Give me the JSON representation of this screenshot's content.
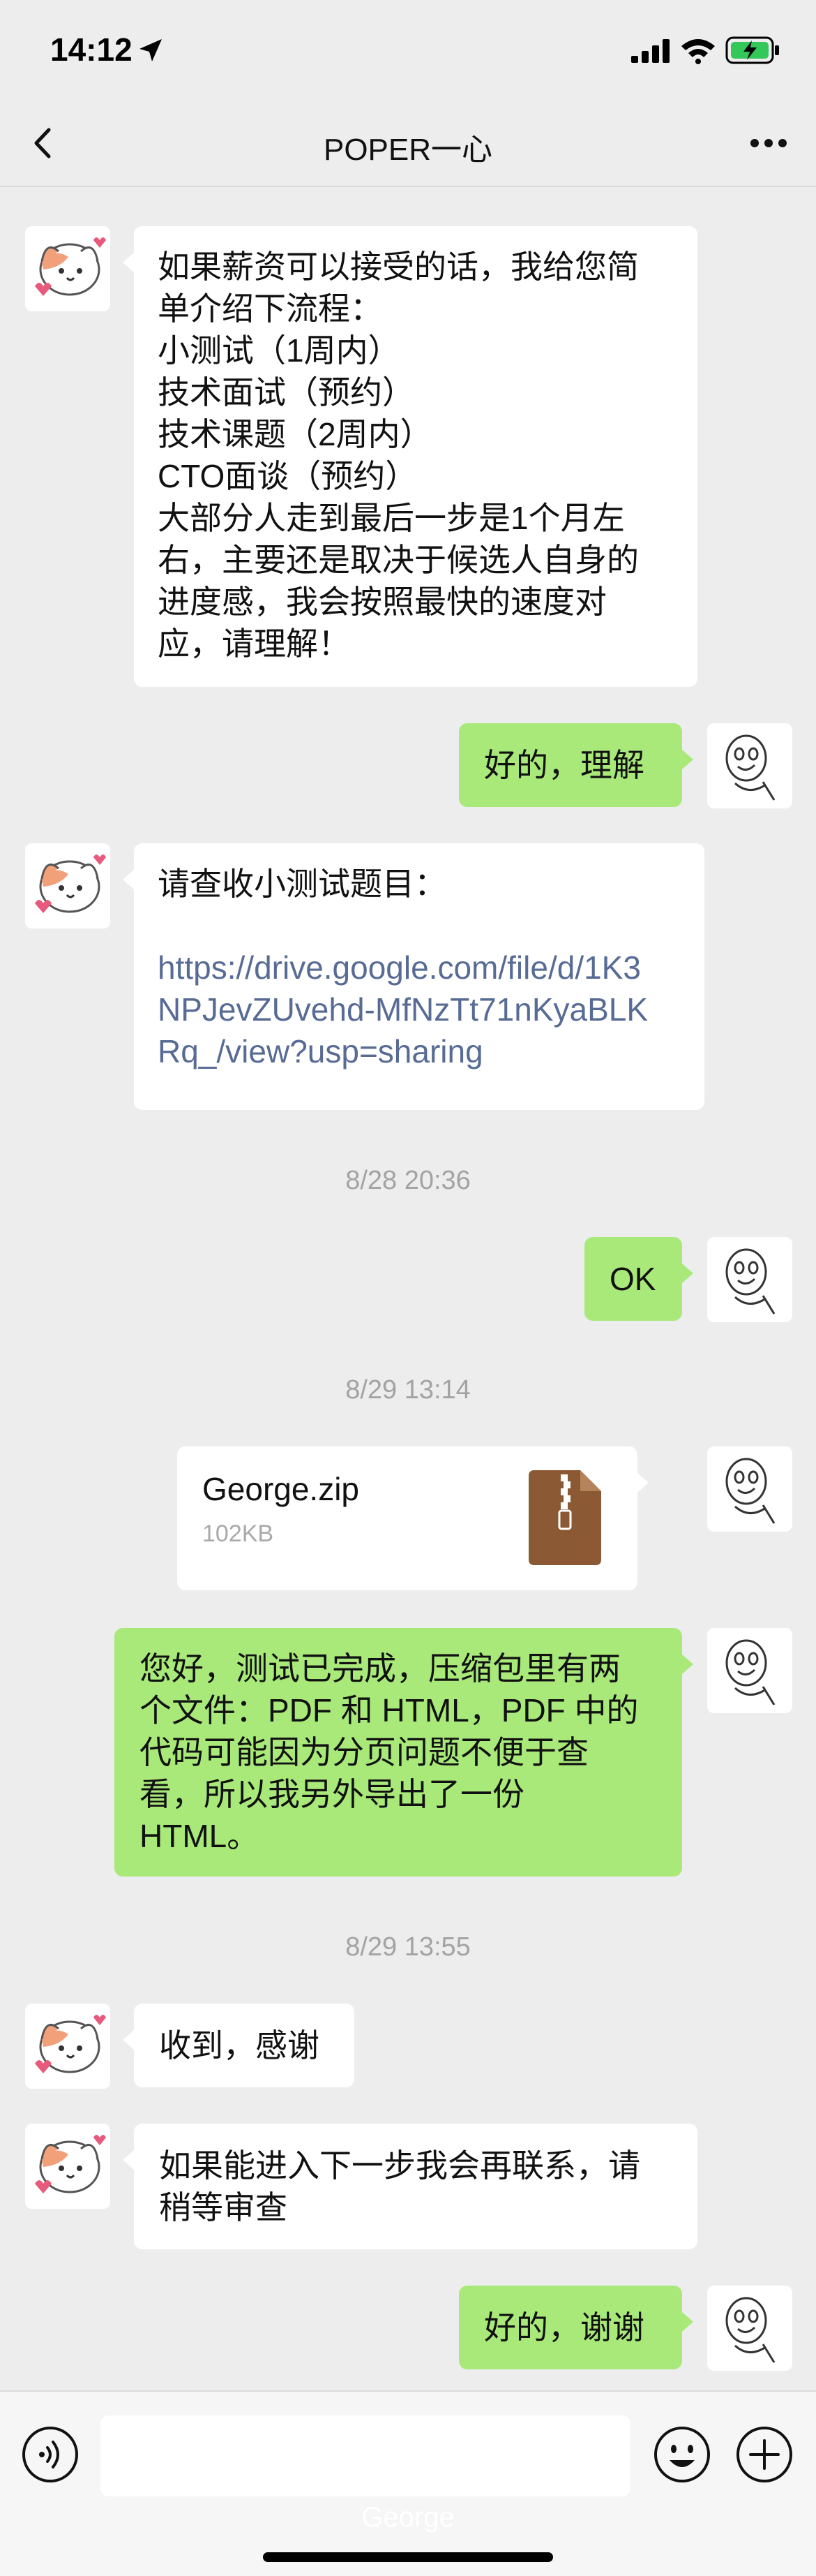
{
  "status_bar": {
    "time": "14:12"
  },
  "header": {
    "title": "POPER一心"
  },
  "messages": [
    {
      "side": "in",
      "text": "如果薪资可以接受的话，我给您简\n单介绍下流程：\n小测试（1周内）\n技术面试（预约）\n技术课题（2周内）\nCTO面谈（预约）\n大部分人走到最后一步是1个月左\n右，主要还是取决于候选人自身的\n进度感，我会按照最快的速度对\n应，请理解！"
    },
    {
      "side": "out",
      "text": "好的，理解"
    },
    {
      "side": "in",
      "text": "请查收小测试题目：",
      "link": "https://drive.google.com/file/d/1K3\nNPJevZUvehd-MfNzTt71nKyaBLK\nRq_/view?usp=sharing"
    },
    {
      "side": "out",
      "text": "OK"
    },
    {
      "side": "out",
      "type": "file",
      "file_name": "George.zip",
      "file_size": "102KB"
    },
    {
      "side": "out",
      "text": "您好，测试已完成，压缩包里有两\n个文件：PDF 和 HTML，PDF 中的\n代码可能因为分页问题不便于查\n看，所以我另外导出了一份\nHTML。"
    },
    {
      "side": "in",
      "text": "收到，感谢"
    },
    {
      "side": "in",
      "text": "如果能进入下一步我会再联系，请\n稍等审查"
    },
    {
      "side": "out",
      "text": "好的，谢谢"
    }
  ],
  "timestamps": [
    "8/28 20:36",
    "8/29 13:14",
    "8/29 13:55"
  ],
  "input": {
    "ghost_text": "George"
  },
  "colors": {
    "background": "#ededed",
    "outgoing_bubble": "#a9e97a",
    "incoming_bubble": "#ffffff",
    "link": "#576b95",
    "timestamp": "#a3a3a3"
  },
  "icons": [
    "location-arrow-icon",
    "cellular-signal-icon",
    "wifi-icon",
    "battery-charging-icon",
    "back-chevron-icon",
    "more-dots-icon",
    "cat-avatar-icon",
    "sketch-face-avatar-icon",
    "zip-file-icon",
    "voice-input-icon",
    "emoji-icon",
    "plus-icon"
  ]
}
